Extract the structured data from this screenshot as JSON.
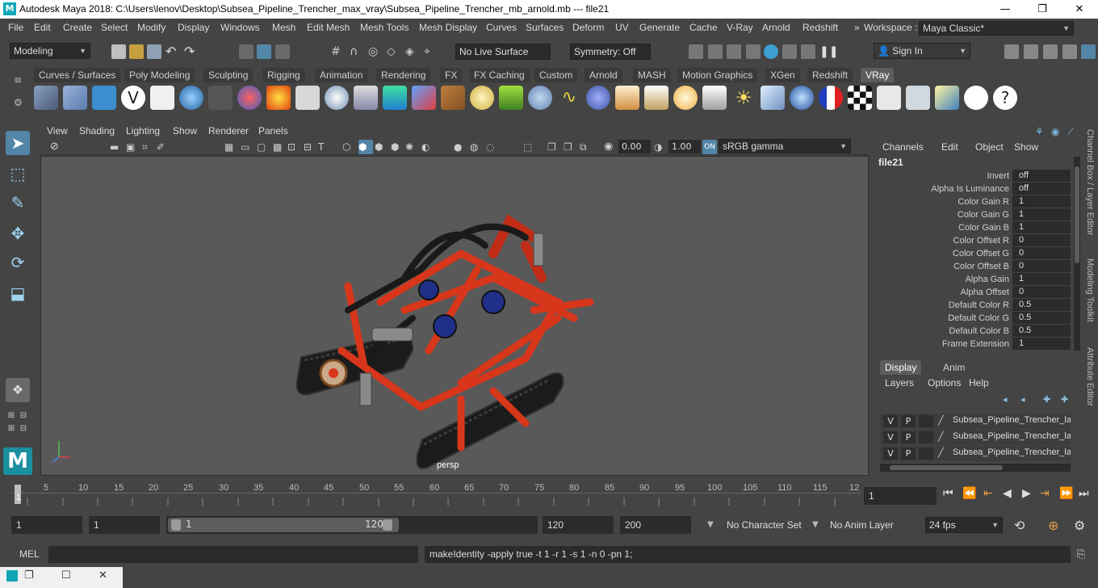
{
  "titlebar": {
    "title": "Autodesk Maya 2018: C:\\Users\\lenov\\Desktop\\Subsea_Pipeline_Trencher_max_vray\\Subsea_Pipeline_Trencher_mb_arnold.mb   ---   file21",
    "app_icon": "M",
    "minimize": "—",
    "maximize": "❐",
    "close": "✕"
  },
  "menubar": {
    "items": [
      "File",
      "Edit",
      "Create",
      "Select",
      "Modify",
      "Display",
      "Windows",
      "Mesh",
      "Edit Mesh",
      "Mesh Tools",
      "Mesh Display",
      "Curves",
      "Surfaces",
      "Deform",
      "UV",
      "Generate",
      "Cache",
      "V-Ray",
      "Arnold",
      "Redshift"
    ],
    "overflow": "»",
    "workspace_label": "Workspace :",
    "workspace_value": "Maya Classic*"
  },
  "statusline": {
    "mode": "Modeling",
    "live_surface": "No Live Surface",
    "symmetry": "Symmetry: Off",
    "sign_in": "Sign In"
  },
  "shelf": {
    "tabs": [
      "Curves / Surfaces",
      "Poly Modeling",
      "Sculpting",
      "Rigging",
      "Animation",
      "Rendering",
      "FX",
      "FX Caching",
      "Custom",
      "Arnold",
      "MASH",
      "Motion Graphics",
      "XGen",
      "Redshift",
      "VRay"
    ],
    "active_tab": "VRay"
  },
  "viewport": {
    "menus": [
      "View",
      "Shading",
      "Lighting",
      "Show",
      "Renderer",
      "Panels"
    ],
    "exposure": "0.00",
    "gamma": "1.00",
    "color_space": "sRGB gamma",
    "camera_label": "persp"
  },
  "channelbox": {
    "menus": [
      "Channels",
      "Edit",
      "Object",
      "Show"
    ],
    "node_name": "file21",
    "attributes": [
      {
        "label": "Invert",
        "value": "off"
      },
      {
        "label": "Alpha Is Luminance",
        "value": "off"
      },
      {
        "label": "Color Gain R",
        "value": "1"
      },
      {
        "label": "Color Gain G",
        "value": "1"
      },
      {
        "label": "Color Gain B",
        "value": "1"
      },
      {
        "label": "Color Offset R",
        "value": "0"
      },
      {
        "label": "Color Offset G",
        "value": "0"
      },
      {
        "label": "Color Offset B",
        "value": "0"
      },
      {
        "label": "Alpha Gain",
        "value": "1"
      },
      {
        "label": "Alpha Offset",
        "value": "0"
      },
      {
        "label": "Default Color R",
        "value": "0.5"
      },
      {
        "label": "Default Color G",
        "value": "0.5"
      },
      {
        "label": "Default Color B",
        "value": "0.5"
      },
      {
        "label": "Frame Extension",
        "value": "1"
      }
    ]
  },
  "layereditor": {
    "tabs": [
      "Display",
      "Anim"
    ],
    "menus": [
      "Layers",
      "Options",
      "Help"
    ],
    "layers": [
      {
        "v": "V",
        "p": "P",
        "name": "Subsea_Pipeline_Trencher_layer1"
      },
      {
        "v": "V",
        "p": "P",
        "name": "Subsea_Pipeline_Trencher_layer2"
      },
      {
        "v": "V",
        "p": "P",
        "name": "Subsea_Pipeline_Trencher_layer3"
      }
    ]
  },
  "sidetabs": [
    "Channel Box / Layer Editor",
    "Modeling Toolkit",
    "Attribute Editor"
  ],
  "timeslider": {
    "ticks": [
      "5",
      "10",
      "15",
      "20",
      "25",
      "30",
      "35",
      "40",
      "45",
      "50",
      "55",
      "60",
      "65",
      "70",
      "75",
      "80",
      "85",
      "90",
      "95",
      "100",
      "105",
      "110",
      "115",
      "12"
    ],
    "current_marker": "1",
    "current_frame": "1"
  },
  "range": {
    "start": "1",
    "playback_start": "1",
    "slider_start": "1",
    "slider_end": "120",
    "playback_end": "120",
    "end": "200",
    "character_set": "No Character Set",
    "anim_layer": "No Anim Layer",
    "fps": "24 fps"
  },
  "cmdline": {
    "label": "MEL",
    "result": "makeIdentity -apply true -t 1 -r 1 -s 1 -n 0 -pn 1;"
  },
  "colors": {
    "accent": "#5285a6",
    "model_red": "#d8361a",
    "model_blue": "#1f2f8a"
  }
}
